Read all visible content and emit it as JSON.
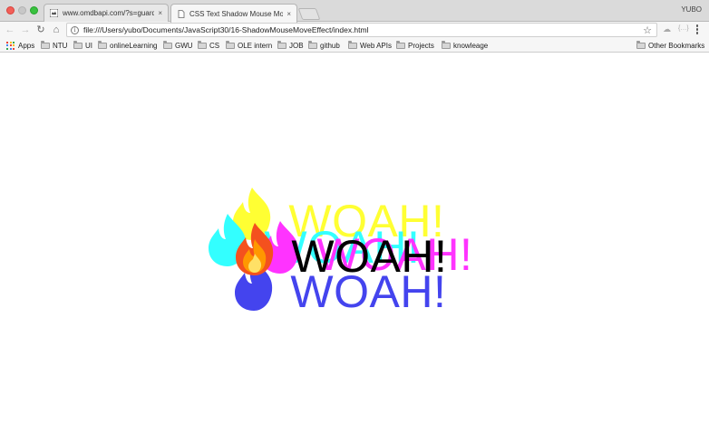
{
  "browser": {
    "profile_name": "YUBO",
    "tabs": [
      {
        "title": "www.omdbapi.com/?s=guardia",
        "close": "×",
        "active": false
      },
      {
        "title": "CSS Text Shadow Mouse Move",
        "close": "×",
        "active": true
      }
    ],
    "address": {
      "url": "file:///Users/yubo/Documents/JavaScript30/16-ShadowMouseMoveEffect/index.html",
      "info_glyph": "i",
      "star_glyph": "☆"
    },
    "nav": {
      "back": "←",
      "forward": "→",
      "reload": "↻",
      "home": "⌂"
    },
    "extensions": [
      "☁",
      "{…}"
    ]
  },
  "bookmarks": {
    "apps_label": "Apps",
    "items": [
      "NTU",
      "UI",
      "onlineLearning",
      "GWU",
      "CS",
      "OLE intern",
      "JOB",
      "github",
      "Web APIs",
      "Projects",
      "knowleage"
    ],
    "other_label": "Other Bookmarks"
  },
  "hero": {
    "emoji": "🔥",
    "text": "WOAH!",
    "layers": [
      {
        "name": "yellow",
        "color": "#ffff33"
      },
      {
        "name": "cyan",
        "color": "#33ffff"
      },
      {
        "name": "magenta",
        "color": "#ff33ff"
      },
      {
        "name": "blue",
        "color": "#4444ee"
      },
      {
        "name": "main",
        "color": "#000000"
      }
    ]
  }
}
